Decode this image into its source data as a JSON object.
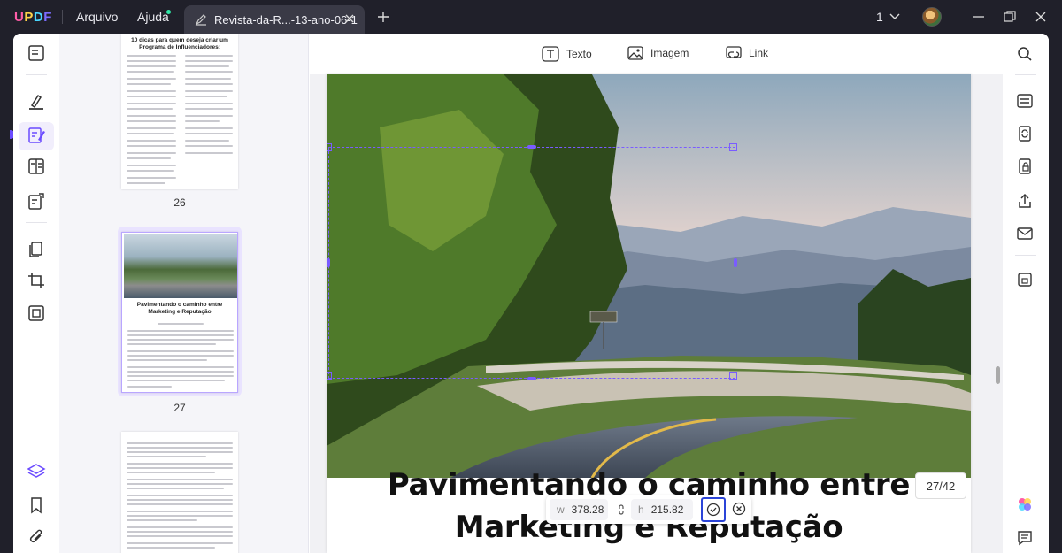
{
  "app": {
    "logo": "UPDF",
    "menu": [
      "Arquivo",
      "Ajuda"
    ],
    "tab_title": "Revista-da-R...-13-ano-06-1",
    "page_count": "1"
  },
  "doc_toolbar": {
    "items": [
      {
        "label": "Texto",
        "icon": "text-icon"
      },
      {
        "label": "Imagem",
        "icon": "image-icon"
      },
      {
        "label": "Link",
        "icon": "link-icon"
      }
    ]
  },
  "thumbnails": [
    {
      "page": "26",
      "heading": "10 dicas para quem deseja criar um Programa de Influenciadores:"
    },
    {
      "page": "27",
      "heading": "Pavimentando o caminho entre Marketing e Reputação"
    },
    {
      "page": ""
    }
  ],
  "page_content": {
    "heading_line1": "Pavimentando o caminho entre",
    "heading_line2": "Marketing e Reputação"
  },
  "image_dims": {
    "w_label": "w",
    "w_value": "378.28",
    "h_label": "h",
    "h_value": "215.82"
  },
  "page_indicator": "27/42",
  "colors": {
    "accent": "#7a5cff",
    "confirm_border": "#2b44d8",
    "titlebar_bg": "#20202a"
  }
}
